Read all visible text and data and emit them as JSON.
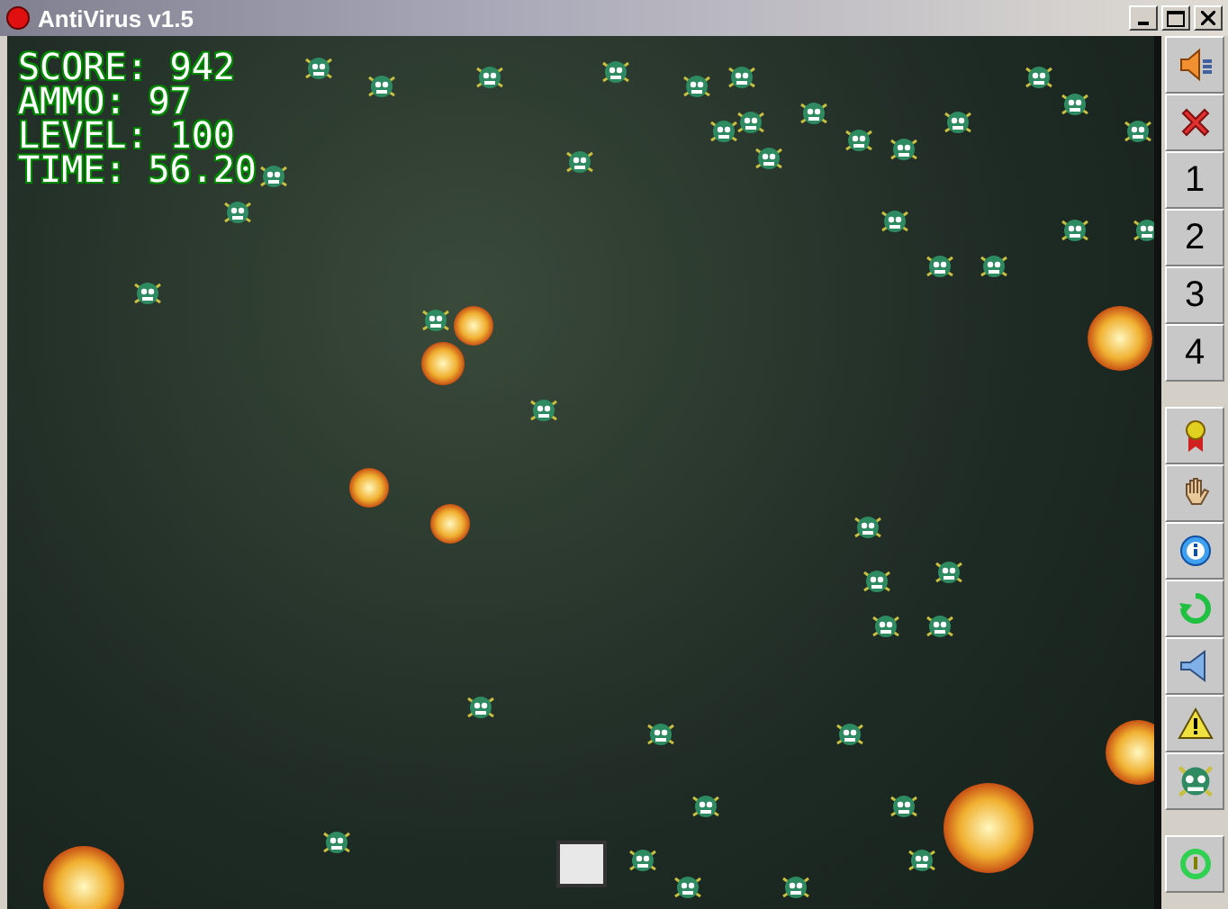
{
  "window": {
    "title": "AntiVirus v1.5"
  },
  "hud": [
    "SCORE: 942",
    "AMMO: 97",
    "LEVEL: 100",
    "TIME: 56.20"
  ],
  "toolbar": {
    "groups": [
      [
        {
          "kind": "speaker"
        },
        {
          "kind": "cross"
        },
        {
          "kind": "number",
          "label": "1"
        },
        {
          "kind": "number",
          "label": "2"
        },
        {
          "kind": "number",
          "label": "3"
        },
        {
          "kind": "number",
          "label": "4"
        }
      ],
      [
        {
          "kind": "medal"
        },
        {
          "kind": "hand"
        },
        {
          "kind": "info"
        },
        {
          "kind": "refresh"
        },
        {
          "kind": "volume"
        },
        {
          "kind": "warning"
        },
        {
          "kind": "virus"
        }
      ],
      [
        {
          "kind": "power"
        }
      ]
    ]
  }
}
